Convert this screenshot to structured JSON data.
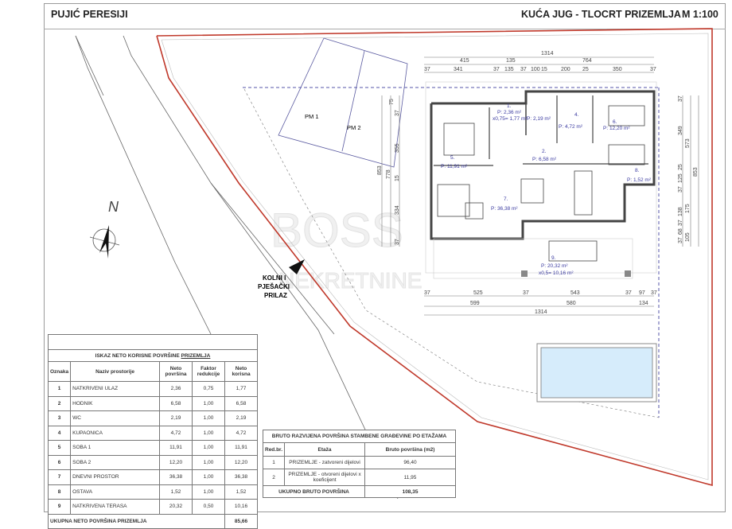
{
  "header": {
    "project": "PUJIĆ PERESIJI",
    "title": "KUĆA JUG - TLOCRT PRIZEMLJA",
    "scale": "M 1:100"
  },
  "site": {
    "parking1": "PM 1",
    "parking2": "PM 2",
    "north": "N",
    "access": [
      "KOLNI I",
      "PJEŠAČKI",
      "PRILAZ"
    ],
    "watermark": [
      "BOSS",
      "NEKRETNINE"
    ]
  },
  "rooms": [
    {
      "num": "1.",
      "area": "P: 2,36 m²",
      "reduced": "x0,75= 1,77 m²"
    },
    {
      "num": "3.",
      "area": "P: 2,19 m²"
    },
    {
      "num": "4.",
      "area": "P: 4,72 m²"
    },
    {
      "num": "6.",
      "area": "P: 12,20 m²"
    },
    {
      "num": "5.",
      "area": "P: 11,91 m²"
    },
    {
      "num": "2.",
      "area": "P: 6,58 m²"
    },
    {
      "num": "8.",
      "area": "P: 1,52 m²"
    },
    {
      "num": "7.",
      "area": "P: 36,38 m²"
    },
    {
      "num": "9.",
      "area": "P: 20,32 m²",
      "reduced": "x0,5= 10,16 m²"
    }
  ],
  "dims": {
    "top1": [
      "1314"
    ],
    "top2": [
      "415",
      "135",
      "764"
    ],
    "top3": [
      "37",
      "341",
      "37",
      "135",
      "37",
      "100",
      "15",
      "200",
      "25",
      "350",
      "37"
    ],
    "left": [
      "853",
      "778",
      "75",
      "37",
      "355",
      "15",
      "334",
      "37"
    ],
    "right": [
      "37",
      "349",
      "573",
      "25",
      "125",
      "37",
      "853",
      "138",
      "175",
      "37",
      "68",
      "37",
      "105"
    ],
    "bottom1": [
      "37",
      "525",
      "37",
      "543",
      "37",
      "97",
      "37"
    ],
    "bottom2": [
      "599",
      "580",
      "134"
    ],
    "bottom3": [
      "1314"
    ]
  },
  "net_table": {
    "title": "ISKAZ NETO KORISNE POVRŠINE ",
    "title_u": "PRIZEMLJA",
    "headers": [
      "Oznaka",
      "Naziv prostorije",
      "Neto površina",
      "Faktor redukcije",
      "Neto korisna"
    ],
    "rows": [
      [
        "1",
        "NATKRIVENI ULAZ",
        "2,36",
        "0,75",
        "1,77"
      ],
      [
        "2",
        "HODNIK",
        "6,58",
        "1,00",
        "6,58"
      ],
      [
        "3",
        "WC",
        "2,19",
        "1,00",
        "2,19"
      ],
      [
        "4",
        "KUPAONICA",
        "4,72",
        "1,00",
        "4,72"
      ],
      [
        "5",
        "SOBA 1",
        "11,91",
        "1,00",
        "11,91"
      ],
      [
        "6",
        "SOBA 2",
        "12,20",
        "1,00",
        "12,20"
      ],
      [
        "7",
        "DNEVNI PROSTOR",
        "36,38",
        "1,00",
        "36,38"
      ],
      [
        "8",
        "OSTAVA",
        "1,52",
        "1,00",
        "1,52"
      ],
      [
        "9",
        "NATKRIVENA TERASA",
        "20,32",
        "0,50",
        "10,16"
      ]
    ],
    "total_label": "UKUPNA NETO POVRŠINA PRIZEMLJA",
    "total": "85,66"
  },
  "gross_table": {
    "title": "BRUTO RAZVIJENA POVRŠINA STAMBENE GRAĐEVINE PO ETAŽAMA",
    "headers": [
      "Red.br.",
      "Etaža",
      "Bruto površina (m2)"
    ],
    "rows": [
      [
        "1",
        "PRIZEMLJE - zatvoreni dijelovi",
        "96,40"
      ],
      [
        "2",
        "PRIZEMLJE - otvoreni dijelovi x koeficijent",
        "11,95"
      ]
    ],
    "total_label": "UKUPNO BRUTO POVRŠINA",
    "total": "108,35"
  },
  "colors": {
    "boundary": "#c0392b",
    "pool": "#d6ecfb",
    "dashed": "#5555aa"
  }
}
